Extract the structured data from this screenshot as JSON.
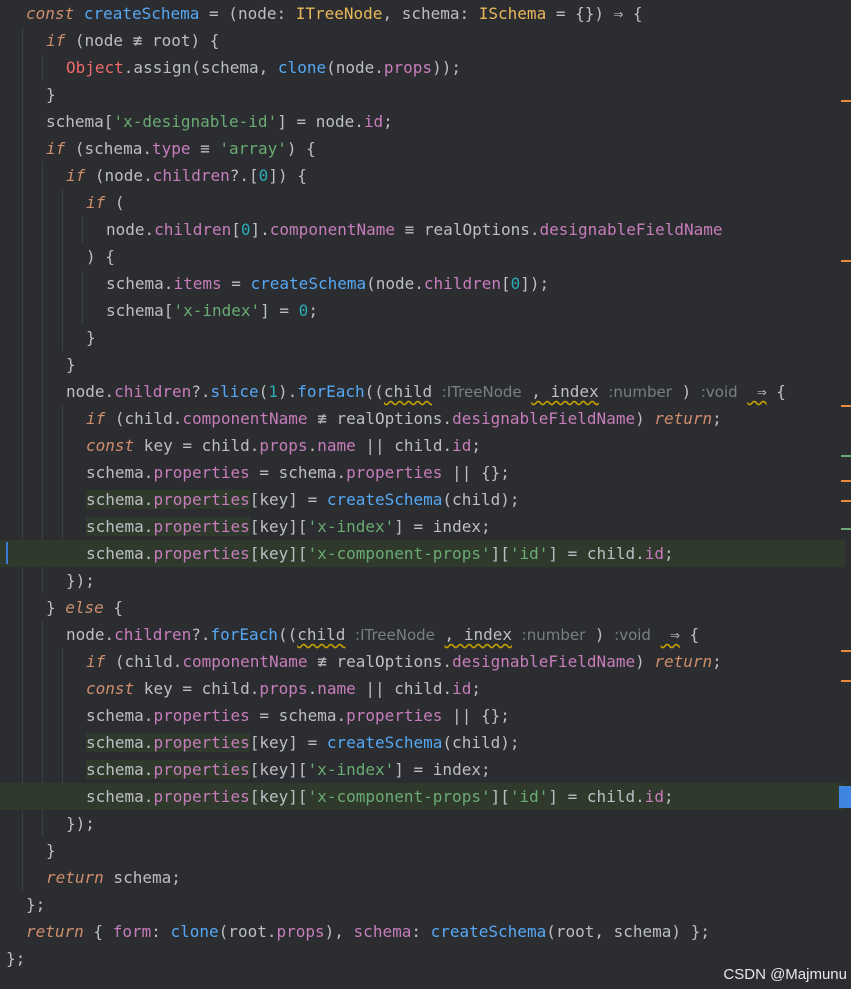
{
  "editor": {
    "lines": [
      "const createSchema = (node: ITreeNode, schema: ISchema = {}) => {",
      "  if (node !== root) {",
      "    Object.assign(schema, clone(node.props));",
      "  }",
      "  schema['x-designable-id'] = node.id;",
      "  if (schema.type === 'array') {",
      "    if (node.children?.[0]) {",
      "      if (",
      "        node.children[0].componentName === realOptions.designableFieldName",
      "      ) {",
      "        schema.items = createSchema(node.children[0]);",
      "        schema['x-index'] = 0;",
      "      }",
      "    }",
      "    node.children?.slice(1).forEach((child, index) => {",
      "      if (child.componentName !== realOptions.designableFieldName) return;",
      "      const key = child.props.name || child.id;",
      "      schema.properties = schema.properties || {};",
      "      schema.properties[key] = createSchema(child);",
      "      schema.properties[key]['x-index'] = index;",
      "      schema.properties[key]['x-component-props']['id'] = child.id;",
      "    });",
      "  } else {",
      "    node.children?.forEach((child, index) => {",
      "      if (child.componentName !== realOptions.designableFieldName) return;",
      "      const key = child.props.name || child.id;",
      "      schema.properties = schema.properties || {};",
      "      schema.properties[key] = createSchema(child);",
      "      schema.properties[key]['x-index'] = index;",
      "      schema.properties[key]['x-component-props']['id'] = child.id;",
      "    });",
      "  }",
      "  return schema;",
      "};",
      "return { form: clone(root.props), schema: createSchema(root, schema) };",
      "};"
    ],
    "inlay_hints": {
      "child_type": "ITreeNode",
      "index_type": "number",
      "return_type": "void"
    }
  },
  "watermark": "CSDN @Majmunu",
  "colors": {
    "background": "#2b2d30",
    "keyword": "#cf8e6d",
    "function": "#56a8f5",
    "type": "#e9b85b",
    "property": "#c77dbb",
    "string": "#6aab73",
    "number": "#2aacb8"
  }
}
